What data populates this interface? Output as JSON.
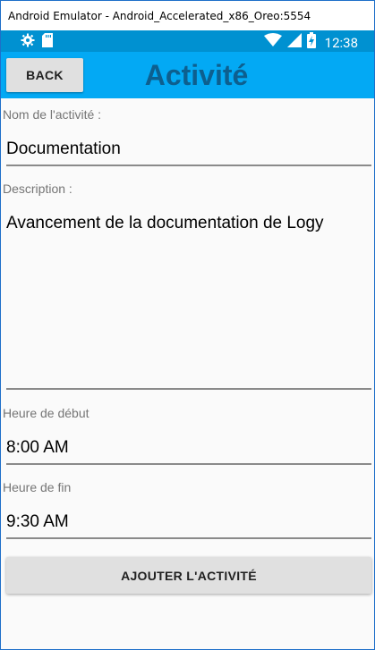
{
  "window": {
    "title": "Android Emulator - Android_Accelerated_x86_Oreo:5554"
  },
  "statusbar": {
    "time": "12:38",
    "icons": [
      "gear-icon",
      "sd-card-icon",
      "wifi-icon",
      "signal-icon",
      "battery-charging-icon"
    ]
  },
  "appbar": {
    "back_label": "BACK",
    "title": "Activité"
  },
  "form": {
    "name_label": "Nom de l'activité :",
    "name_value": "Documentation",
    "description_label": "Description :",
    "description_value": "Avancement de la documentation de Logy",
    "start_label": "Heure de début",
    "start_value": "8:00 AM",
    "end_label": "Heure de fin",
    "end_value": "9:30 AM",
    "submit_label": "AJOUTER L'ACTIVITÉ"
  },
  "colors": {
    "statusbar": "#0091d1",
    "appbar": "#03a9f4",
    "title": "#0d5f8f",
    "window_border": "#1e6fc9"
  }
}
